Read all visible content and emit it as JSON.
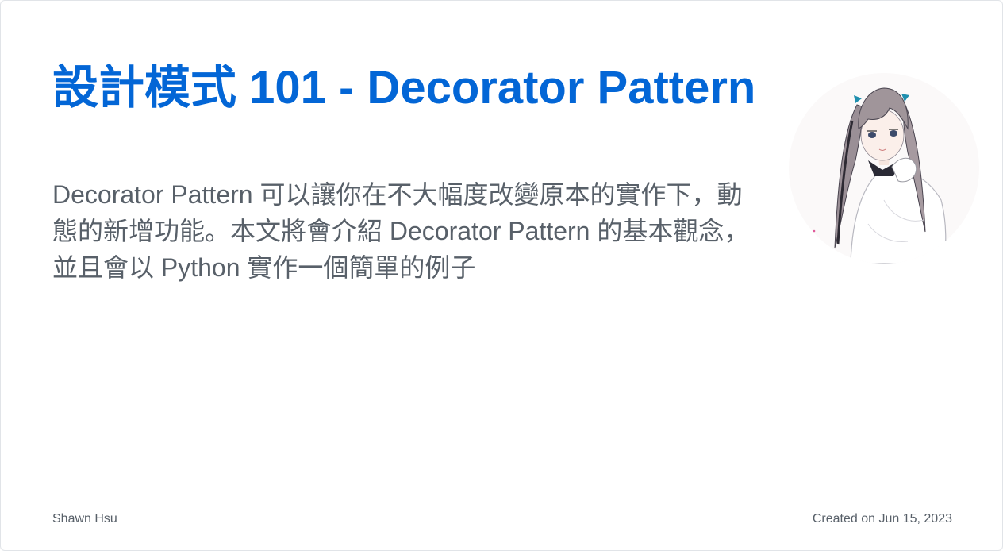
{
  "post": {
    "title": "設計模式 101 - Decorator Pattern",
    "description": "Decorator Pattern 可以讓你在不大幅度改變原本的實作下，動態的新增功能。本文將會介紹 Decorator Pattern 的基本觀念，並且會以 Python 實作一個簡單的例子",
    "author": "Shawn Hsu",
    "created": "Created on Jun 15, 2023"
  },
  "avatar": {
    "icon": "anime-girl-avatar-icon"
  },
  "colors": {
    "title": "#0366d6",
    "text": "#586069",
    "border": "#e1e4e8"
  }
}
